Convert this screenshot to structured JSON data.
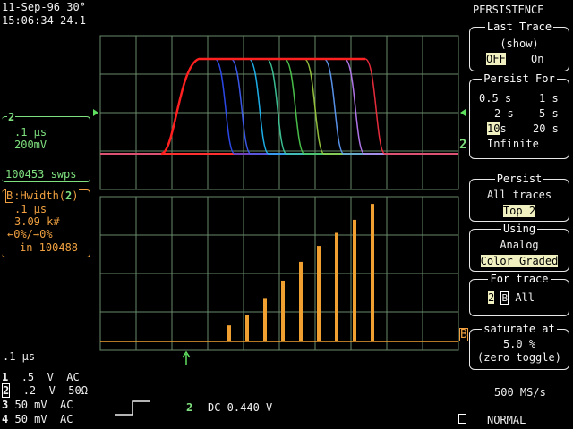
{
  "header": {
    "date": "11-Sep-96 30°",
    "time": "15:06:34 24.1"
  },
  "menu": {
    "title": "PERSISTENCE",
    "last_trace": {
      "label": "Last Trace",
      "sub": "(show)",
      "off": "OFF",
      "on": "On"
    },
    "persist_for": {
      "label": "Persist For",
      "opts": [
        "0.5 s",
        "1 s",
        "2 s",
        "5 s",
        "10",
        "s",
        "20 s",
        "Infinite"
      ]
    },
    "persist": {
      "label": "Persist",
      "line1": "All traces",
      "line2": "Top 2"
    },
    "using": {
      "label": "Using",
      "line1": "Analog",
      "line2": "Color Graded"
    },
    "for_trace": {
      "label": "For trace",
      "t2": "2",
      "tb": "B",
      "all": "All"
    },
    "saturate": {
      "label": "saturate at",
      "value": "5.0 %",
      "note": "(zero toggle)"
    }
  },
  "trace2": {
    "id": "2",
    "timebase": ".1 μs",
    "volts": "200mV",
    "sweeps": "100453 swps"
  },
  "traceB": {
    "id": "B",
    "func": ":Hwidth(",
    "src": "2",
    "close": ")",
    "timebase": ".1 μs",
    "value": "3.09 k#",
    "range": "←0%/→0%",
    "count": "in 100488"
  },
  "footer": {
    "timebase": ".1 μs",
    "channels": [
      {
        "n": "1",
        "v": ".5  V",
        "c": "AC"
      },
      {
        "n": "2",
        "v": ".2  V",
        "c": "50Ω"
      },
      {
        "n": "3",
        "v": "50 mV",
        "c": "AC"
      },
      {
        "n": "4",
        "v": "50 mV",
        "c": "AC"
      }
    ],
    "trig_ch": "2",
    "trig_info": "DC 0.440 V",
    "rate": "500 MS/s",
    "mode": "NORMAL"
  },
  "markers": {
    "trace_right": "2",
    "hist_right": "B"
  },
  "colors": {
    "grid": "#6a8a6a",
    "trace_green": "#60e060",
    "hist": "#f0a030",
    "menu": "#e8e8e8"
  },
  "histogram": {
    "values": [
      0.11,
      0.18,
      0.3,
      0.42,
      0.55,
      0.66,
      0.75,
      0.84,
      0.95
    ]
  }
}
